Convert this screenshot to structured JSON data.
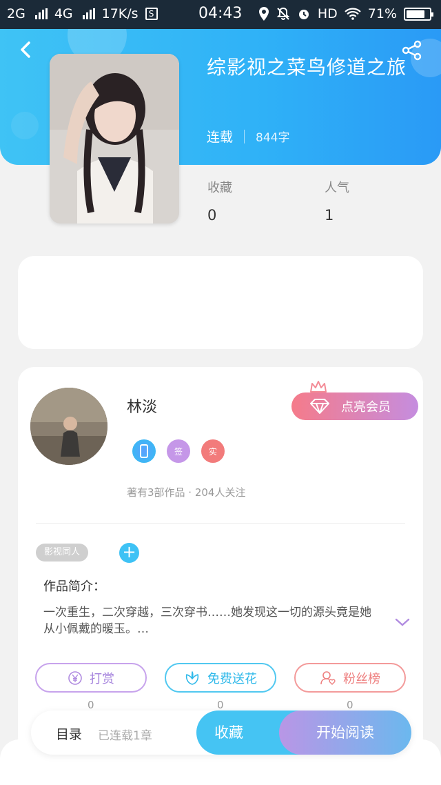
{
  "status_bar": {
    "network1": "2G",
    "network2": "4G",
    "speed": "17K/s",
    "speed_badge": "S",
    "time": "04:43",
    "hd": "HD",
    "battery": "71%"
  },
  "book": {
    "title": "综影视之菜鸟修道之旅",
    "status": "连载",
    "word_count": "844字",
    "stats": [
      {
        "label": "收藏",
        "value": "0"
      },
      {
        "label": "人气",
        "value": "1"
      }
    ]
  },
  "author": {
    "name": "林淡",
    "badges": [
      {
        "icon": "phone-verified-icon",
        "text": ""
      },
      {
        "icon": "signed-icon",
        "text": "签"
      },
      {
        "icon": "real-name-icon",
        "text": "实"
      }
    ],
    "works_info": "著有3部作品 · 204人关注",
    "vip_button": "点亮会员"
  },
  "tags": [
    "影视同人"
  ],
  "add_tag_label": "+",
  "intro": {
    "label": "作品简介：",
    "text": "一次重生，二次穿越，三次穿书……她发现这一切的源头竟是她从小佩戴的暖玉。…"
  },
  "actions": [
    {
      "label": "打赏",
      "count": "0",
      "icon": "yuan-icon"
    },
    {
      "label": "免费送花",
      "count": "0",
      "icon": "flower-icon"
    },
    {
      "label": "粉丝榜",
      "count": "0",
      "icon": "fan-icon"
    }
  ],
  "bottom_bar": {
    "toc": "目录",
    "toc_sub": "已连载1章",
    "favorite": "收藏",
    "start_reading": "开始阅读"
  },
  "colors": {
    "header_blue": "#2fb1f7",
    "accent_cyan": "#45c4f3",
    "vip_gradient_start": "#f57b8a",
    "vip_gradient_end": "#c58ddf"
  }
}
